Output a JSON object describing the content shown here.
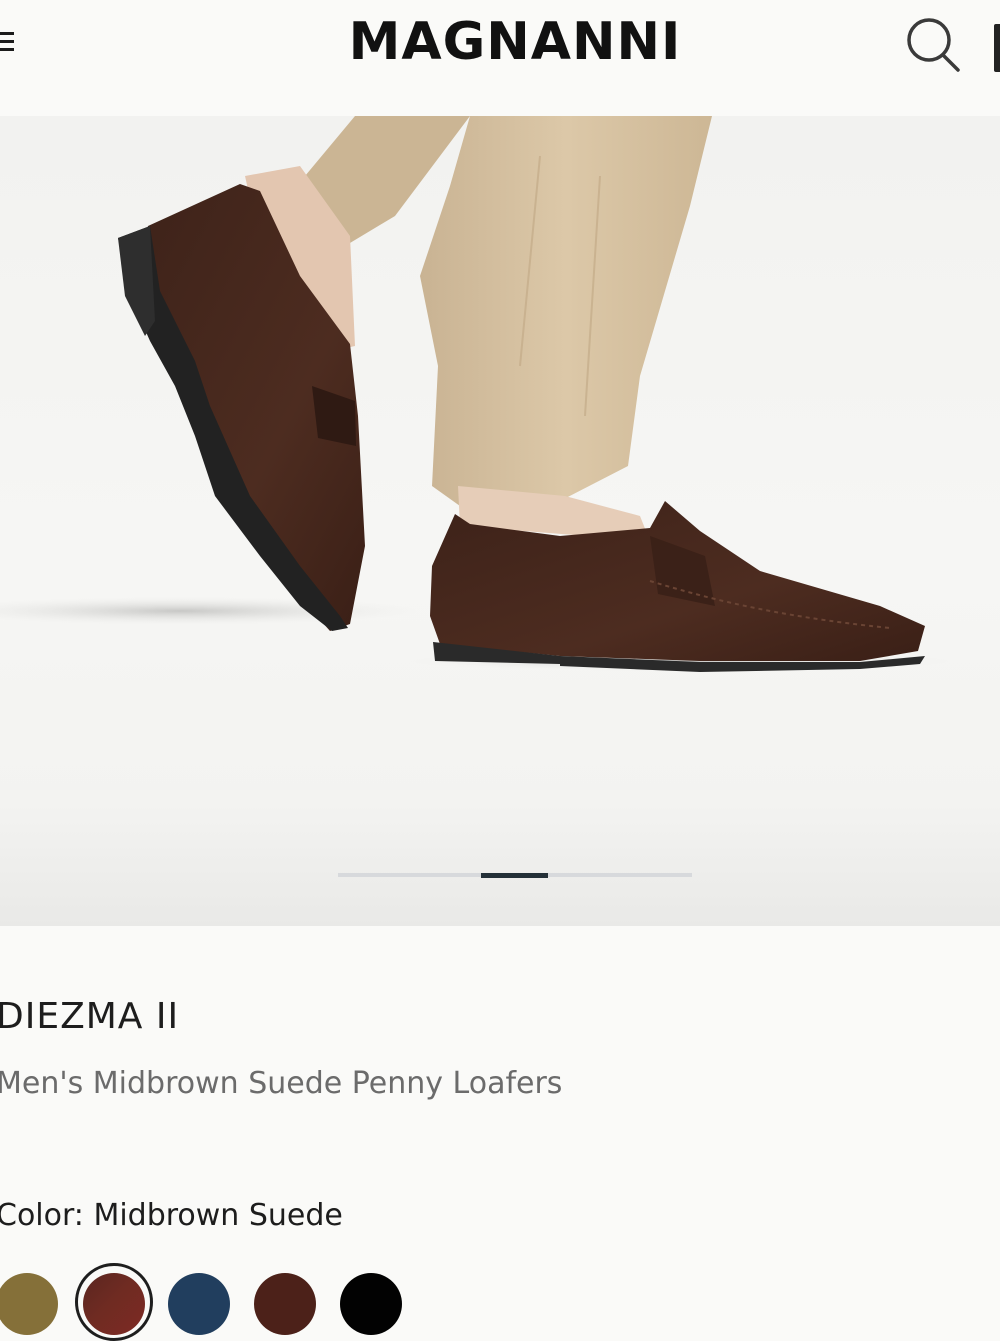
{
  "header": {
    "brand": "MAGNANNI",
    "menu_icon": "hamburger-menu-icon",
    "search_icon": "search-icon",
    "bag_icon": "shopping-bag-icon"
  },
  "gallery": {
    "image_alt": "Midbrown suede penny loafers worn with beige trousers",
    "slide_count": 5,
    "active_slide": 3
  },
  "product": {
    "name": "DIEZMA II",
    "subtitle": "Men's Midbrown Suede Penny Loafers",
    "color_label": "Color: Midbrown Suede"
  },
  "swatches": [
    {
      "name": "olive",
      "color": "#857039",
      "selected": false
    },
    {
      "name": "midbrown-suede",
      "color": "#6b2a22",
      "selected": true
    },
    {
      "name": "navy",
      "color": "#213e5e",
      "selected": false
    },
    {
      "name": "brown",
      "color": "#4c2119",
      "selected": false
    },
    {
      "name": "black",
      "color": "#020202",
      "selected": false
    }
  ]
}
